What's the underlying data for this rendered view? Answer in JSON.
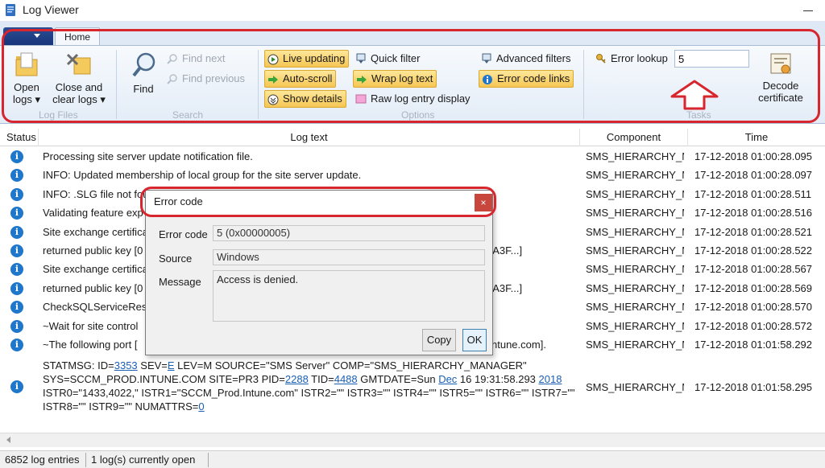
{
  "window": {
    "title": "Log Viewer"
  },
  "ribbon": {
    "tab_home": "Home",
    "log_files": {
      "group_label": "Log Files",
      "open_logs": [
        "Open",
        "logs ▾"
      ],
      "close_clear": [
        "Close and",
        "clear logs ▾"
      ]
    },
    "search": {
      "group_label": "Search",
      "find": "Find",
      "find_next": "Find next",
      "find_previous": "Find previous"
    },
    "options": {
      "group_label": "Options",
      "live_updating": "Live updating",
      "auto_scroll": "Auto-scroll",
      "show_details": "Show details",
      "quick_filter": "Quick filter",
      "wrap_log_text": "Wrap log text",
      "raw_log_entry": "Raw log entry display",
      "advanced_filters": "Advanced filters",
      "error_code_links": "Error code links"
    },
    "tasks": {
      "group_label": "Tasks",
      "error_lookup_label": "Error lookup",
      "error_lookup_value": "5",
      "decode_certificate": [
        "Decode",
        "certificate"
      ]
    }
  },
  "grid": {
    "headers": {
      "status": "Status",
      "log_text": "Log text",
      "component": "Component",
      "time": "Time"
    },
    "rows": [
      {
        "text": "Processing site server update notification file.",
        "tail": "",
        "component": "SMS_HIERARCHY_MANAGER",
        "time": "17-12-2018 01:00:28.095"
      },
      {
        "text": "INFO: Updated membership of local group for the site server update.",
        "tail": "",
        "component": "SMS_HIERARCHY_MANAGER",
        "time": "17-12-2018 01:00:28.097"
      },
      {
        "text": "INFO: .SLG file not fou",
        "tail": "",
        "component": "SMS_HIERARCHY_MANAGER",
        "time": "17-12-2018 01:00:28.511"
      },
      {
        "text": "Validating feature exp",
        "tail": "",
        "component": "SMS_HIERARCHY_MANAGER",
        "time": "17-12-2018 01:00:28.516"
      },
      {
        "text": "Site exchange certifica",
        "tail": "",
        "component": "SMS_HIERARCHY_MANAGER",
        "time": "17-12-2018 01:00:28.521"
      },
      {
        "text": "returned public key [0",
        "tail": "3A3F...]",
        "component": "SMS_HIERARCHY_MANAGER",
        "time": "17-12-2018 01:00:28.522"
      },
      {
        "text": "Site exchange certifica",
        "tail": "",
        "component": "SMS_HIERARCHY_MANAGER",
        "time": "17-12-2018 01:00:28.567"
      },
      {
        "text": "returned public key [0",
        "tail": "3A3F...]",
        "component": "SMS_HIERARCHY_MANAGER",
        "time": "17-12-2018 01:00:28.569"
      },
      {
        "text": "CheckSQLServiceResta",
        "tail": "",
        "component": "SMS_HIERARCHY_MANAGER",
        "time": "17-12-2018 01:00:28.570"
      },
      {
        "text": "~Wait for site control",
        "tail": "",
        "component": "SMS_HIERARCHY_MANAGER",
        "time": "17-12-2018 01:00:28.572"
      },
      {
        "text": "~The following port [",
        "tail": "ntune.com].",
        "component": "SMS_HIERARCHY_MANAGER",
        "time": "17-12-2018 01:01:58.292"
      }
    ],
    "statmsg": {
      "p1": "STATMSG: ID=",
      "l1": "3353",
      "p2": " SEV=",
      "l2": "E",
      "p3": " LEV=M SOURCE=\"SMS Server\" COMP=\"SMS_HIERARCHY_MANAGER\" SYS=SCCM_PROD.INTUNE.COM SITE=PR3 PID=",
      "l3": "2288",
      "p4": " TID=",
      "l4": "4488",
      "p5": " GMTDATE=Sun ",
      "l5": "Dec",
      "p6": " 16 19:31:58.293 ",
      "l6": "2018",
      "p7": " ISTR0=\"1433,4022,\" ISTR1=\"SCCM_Prod.Intune.com\" ISTR2=\"\" ISTR3=\"\" ISTR4=\"\" ISTR5=\"\" ISTR6=\"\" ISTR7=\"\" ISTR8=\"\" ISTR9=\"\" NUMATTRS=",
      "l7": "0",
      "component": "SMS_HIERARCHY_MANAGER",
      "time": "17-12-2018 01:01:58.295"
    }
  },
  "statusbar": {
    "entries": "6852 log entries",
    "open": "1 log(s) currently open"
  },
  "dialog": {
    "title": "Error code",
    "close": "×",
    "error_code_label": "Error code",
    "error_code_value": "5 (0x00000005)",
    "source_label": "Source",
    "source_value": "Windows",
    "message_label": "Message",
    "message_value": "Access is denied.",
    "copy": "Copy",
    "ok": "OK"
  },
  "colors": {
    "accent_red": "#d7262e",
    "info_blue": "#1f77cc",
    "toggle_gold": "#f6c654"
  }
}
